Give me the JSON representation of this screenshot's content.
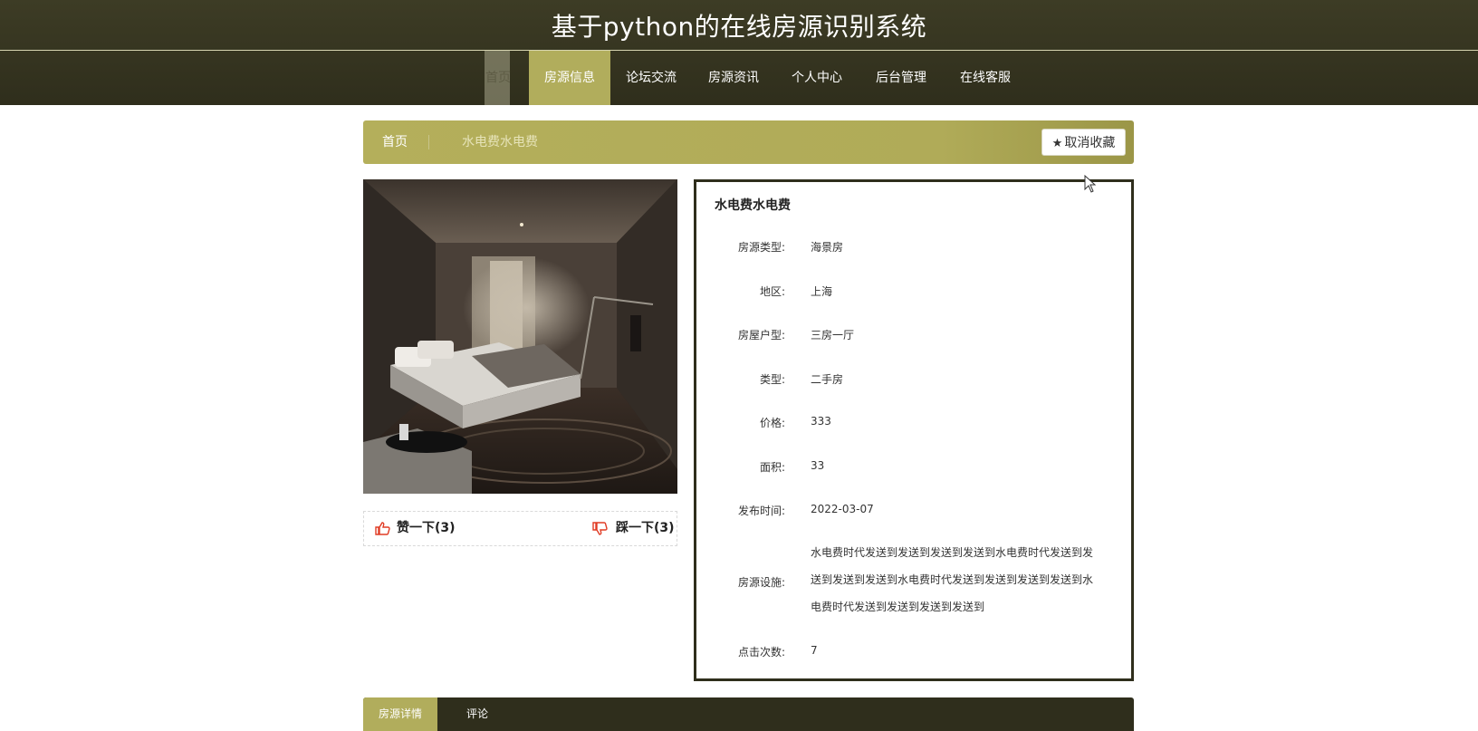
{
  "header": {
    "site_title": "基于python的在线房源识别系统"
  },
  "nav": {
    "items": [
      {
        "label": "首页"
      },
      {
        "label": "房源信息"
      },
      {
        "label": "论坛交流"
      },
      {
        "label": "房源资讯"
      },
      {
        "label": "个人中心"
      },
      {
        "label": "后台管理"
      },
      {
        "label": "在线客服"
      }
    ],
    "active_index": 1
  },
  "breadcrumb": {
    "home": "首页",
    "current": "水电费水电费"
  },
  "favorite_button": {
    "label": "取消收藏",
    "icon": "star-icon"
  },
  "votes": {
    "like_label": "赞一下(3)",
    "dislike_label": "踩一下(3)"
  },
  "detail": {
    "title": "水电费水电费",
    "rows": [
      {
        "label": "房源类型:",
        "value": "海景房"
      },
      {
        "label": "地区:",
        "value": "上海"
      },
      {
        "label": "房屋户型:",
        "value": "三房一厅"
      },
      {
        "label": "类型:",
        "value": "二手房"
      },
      {
        "label": "价格:",
        "value": "333"
      },
      {
        "label": "面积:",
        "value": "33"
      },
      {
        "label": "发布时间:",
        "value": "2022-03-07"
      },
      {
        "label": "房源设施:",
        "value": "水电费时代发送到发送到发送到发送到水电费时代发送到发送到发送到发送到水电费时代发送到发送到发送到发送到水电费时代发送到发送到发送到发送到"
      },
      {
        "label": "点击次数:",
        "value": "7"
      }
    ]
  },
  "tabs": [
    {
      "label": "房源详情"
    },
    {
      "label": "评论"
    }
  ],
  "colors": {
    "header_dark": "#2f2e1c",
    "accent_olive": "#b1ad5c",
    "like_red": "#e03b24"
  }
}
